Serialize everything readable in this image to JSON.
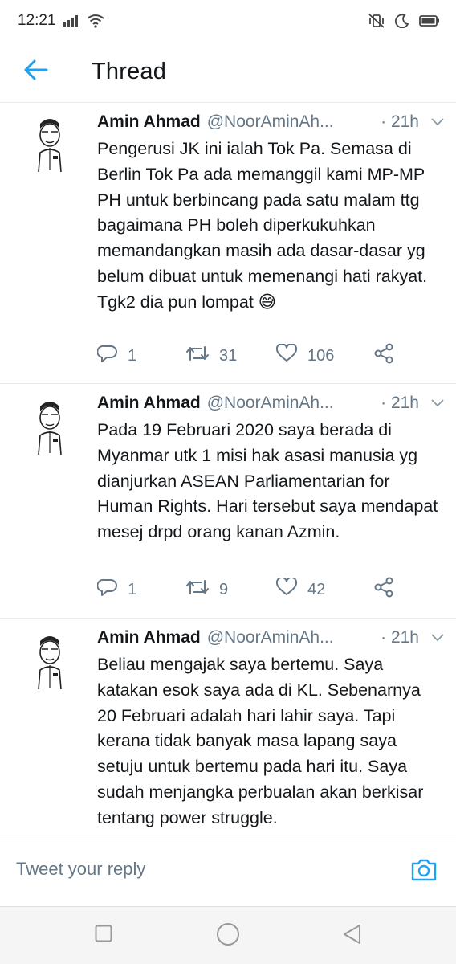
{
  "status_bar": {
    "time": "12:21"
  },
  "header": {
    "title": "Thread",
    "back_icon": "arrow-left-icon"
  },
  "tweets": [
    {
      "name": "Amin Ahmad",
      "handle": "@NoorAminAh...",
      "time": "· 21h",
      "text": "Pengerusi JK ini ialah Tok Pa. Semasa di Berlin Tok Pa ada memanggil kami MP-MP PH untuk berbincang pada satu malam ttg bagaimana PH boleh diperkukuhkan memandangkan masih ada dasar-dasar yg belum dibuat untuk memenangi hati rakyat. Tgk2 dia pun lompat 😅",
      "replies": "1",
      "retweets": "31",
      "likes": "106"
    },
    {
      "name": "Amin Ahmad",
      "handle": "@NoorAminAh...",
      "time": "· 21h",
      "text": "Pada 19 Februari 2020 saya berada di Myanmar utk 1 misi hak asasi manusia yg dianjurkan ASEAN Parliamentarian for Human Rights. Hari tersebut saya mendapat mesej drpd orang kanan Azmin.",
      "replies": "1",
      "retweets": "9",
      "likes": "42"
    },
    {
      "name": "Amin Ahmad",
      "handle": "@NoorAminAh...",
      "time": "· 21h",
      "text": "Beliau mengajak saya bertemu. Saya katakan esok saya ada di KL. Sebenarnya 20 Februari adalah hari lahir saya. Tapi kerana tidak banyak masa lapang saya setuju untuk bertemu pada hari itu. Saya sudah menjangka perbualan akan berkisar tentang power struggle."
    }
  ],
  "reply_bar": {
    "placeholder": "Tweet your reply"
  },
  "colors": {
    "accent": "#1da1f2",
    "text": "#14171a",
    "secondary": "#657786",
    "divider": "#e6ecf0"
  }
}
